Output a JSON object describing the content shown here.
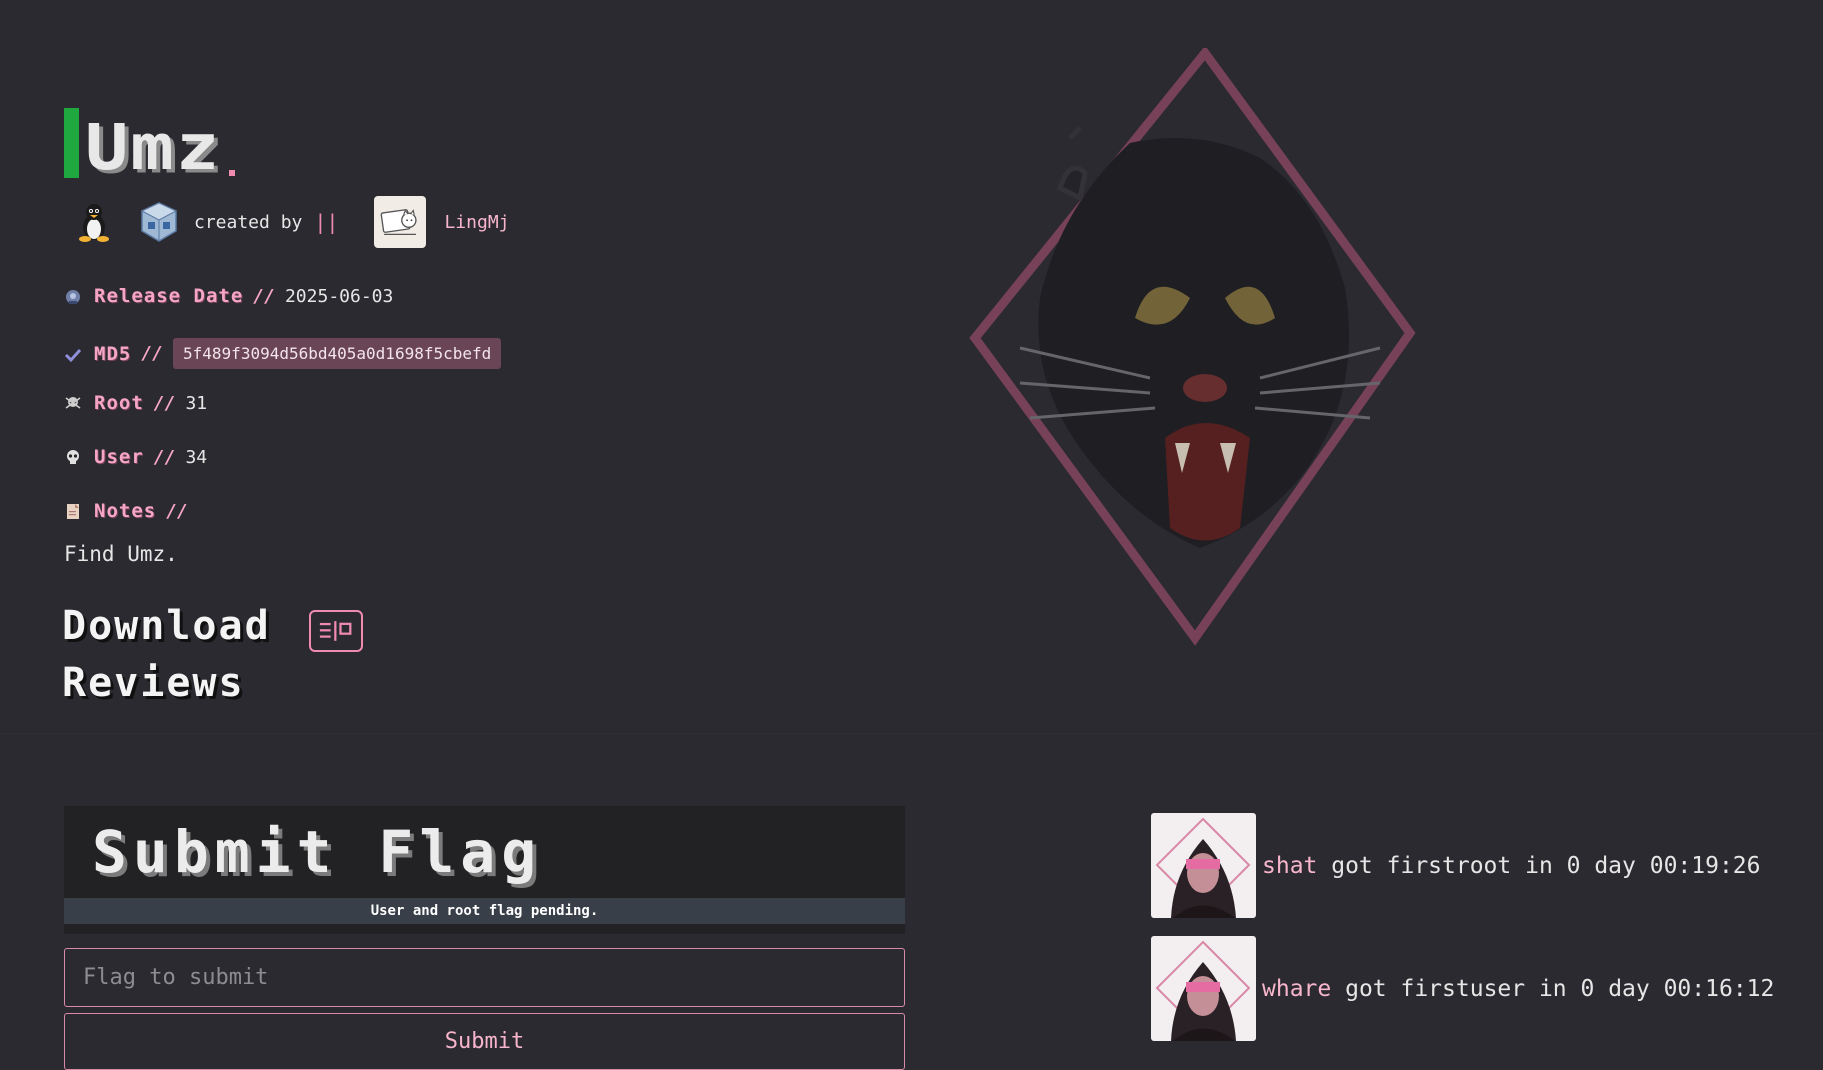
{
  "machine": {
    "title": "Umz",
    "created_by_label": "created by",
    "created_by_sep": "||",
    "author": "LingMj",
    "os_icon": "linux-penguin-icon",
    "platform_icon": "virtualbox-icon"
  },
  "meta": {
    "release": {
      "label": "Release Date",
      "sep": "//",
      "value": "2025-06-03"
    },
    "md5": {
      "label": "MD5",
      "sep": "//",
      "value": "5f489f3094d56bd405a0d1698f5cbefd"
    },
    "root": {
      "label": "Root",
      "sep": "//",
      "value": "31"
    },
    "user": {
      "label": "User",
      "sep": "//",
      "value": "34"
    },
    "notes": {
      "label": "Notes",
      "sep": "//",
      "value": "Find Umz."
    }
  },
  "sections": {
    "download": "Download",
    "reviews": "Reviews"
  },
  "flag": {
    "title": "Submit Flag",
    "status": "User and root flag pending.",
    "placeholder": "Flag to submit",
    "submit_label": "Submit"
  },
  "bloods": [
    {
      "user": "shat",
      "text": " got firstroot in 0 day 00:19:26"
    },
    {
      "user": "whare",
      "text": " got firstuser in 0 day 00:16:12"
    }
  ],
  "colors": {
    "accent_pink": "#f08bb0",
    "accent_green": "#1fa83f",
    "background": "#2b2a30"
  }
}
